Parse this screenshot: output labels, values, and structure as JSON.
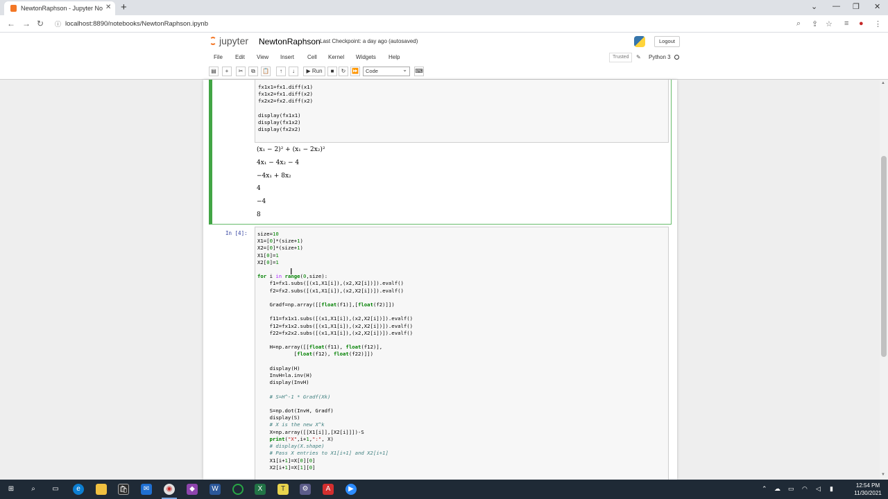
{
  "browser": {
    "tab_title": "NewtonRaphson - Jupyter Notebo",
    "url": "localhost:8890/notebooks/NewtonRaphson.ipynb"
  },
  "jupyter": {
    "logo_text": "jupyter",
    "notebook_name": "NewtonRaphson",
    "checkpoint": "Last Checkpoint: a day ago  (autosaved)",
    "logout_label": "Logout",
    "menu": [
      "File",
      "Edit",
      "View",
      "Insert",
      "Cell",
      "Kernel",
      "Widgets",
      "Help"
    ],
    "trusted": "Trusted",
    "kernel": "Python 3",
    "run_label": "Run",
    "cell_type": "Code"
  },
  "cell1": {
    "code": "fx1x1=fx1.diff(x1)\nfx1x2=fx1.diff(x2)\nfx2x2=fx2.diff(x2)\n\ndisplay(fx1x1)\ndisplay(fx1x2)\ndisplay(fx2x2)",
    "outputs": [
      "(x₁ − 2)² + (x₁ − 2x₂)²",
      "4x₁ − 4x₂ − 4",
      "−4x₁ + 8x₂",
      "4",
      "−4",
      "8"
    ]
  },
  "cell2": {
    "prompt": "In [4]:"
  },
  "taskbar": {
    "time": "12:54 PM",
    "date": "11/30/2021"
  }
}
